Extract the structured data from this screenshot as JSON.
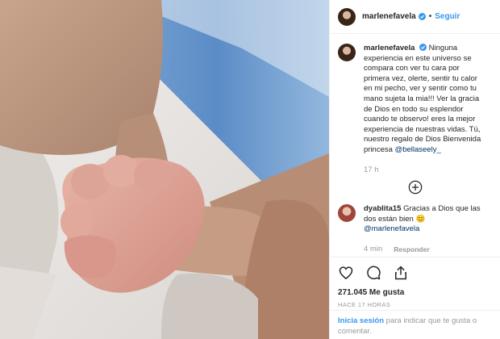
{
  "header": {
    "username": "marlenefavela",
    "follow_label": "Seguir"
  },
  "caption": {
    "username": "marlenefavela",
    "text": "Ninguna experiencia en este universo se compara con ver tu cara por primera vez, olerte, sentir tu calor en mi pecho, ver y sentir como tu mano sujeta la mia!!! Ver la gracia de Dios en todo su esplendor cuando te observo! eres la mejor experiencia de nuestras vidas. Tú, nuestro regalo de Dios Bienvenida princesa",
    "mention": "@bellaseely_",
    "time": "17 h"
  },
  "comment": {
    "username": "dyablita15",
    "text": "Gracias a Dios que las dos están bien",
    "emoji": "😊",
    "mention": "@marlenefavela",
    "time": "4 min",
    "reply_label": "Responder"
  },
  "stats": {
    "likes": "271.045 Me gusta",
    "posted": "HACE 17 HORAS"
  },
  "login": {
    "link": "Inicia sesión",
    "rest": "para indicar que te gusta o comentar."
  },
  "colors": {
    "accent": "#3897f0",
    "text": "#262626",
    "muted": "#999999"
  },
  "icons": [
    "verified-badge-icon",
    "add-comment-icon",
    "heart-icon",
    "comment-icon",
    "share-icon"
  ]
}
